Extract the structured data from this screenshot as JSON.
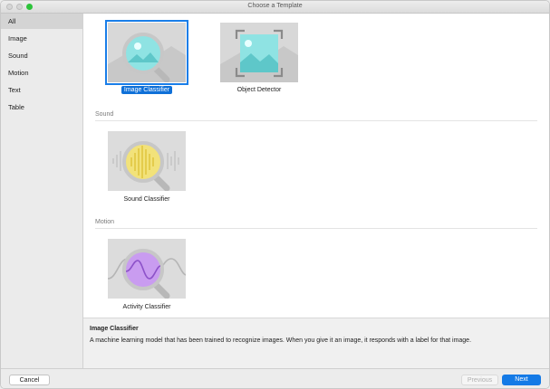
{
  "window": {
    "title": "Choose a Template"
  },
  "sidebar": {
    "items": [
      {
        "label": "All"
      },
      {
        "label": "Image"
      },
      {
        "label": "Sound"
      },
      {
        "label": "Motion"
      },
      {
        "label": "Text"
      },
      {
        "label": "Table"
      }
    ],
    "selected": "All"
  },
  "sections": {
    "image": {
      "header": "",
      "templates": [
        {
          "label": "Image Classifier",
          "selected": true,
          "icon": "image-classifier-icon"
        },
        {
          "label": "Object Detector",
          "selected": false,
          "icon": "object-detector-icon"
        }
      ]
    },
    "sound": {
      "header": "Sound",
      "templates": [
        {
          "label": "Sound Classifier",
          "selected": false,
          "icon": "sound-classifier-icon"
        }
      ]
    },
    "motion": {
      "header": "Motion",
      "templates": [
        {
          "label": "Activity Classifier",
          "selected": false,
          "icon": "activity-classifier-icon"
        }
      ]
    }
  },
  "description": {
    "title": "Image Classifier",
    "text": "A machine learning model that has been trained to recognize images. When you give it an image, it responds with a label for that image."
  },
  "footer": {
    "cancel_label": "Cancel",
    "previous_label": "Previous",
    "next_label": "Next"
  },
  "colors": {
    "accent": "#147ae6",
    "image_teal": "#8fe3e3",
    "sound_yellow": "#f2e27a",
    "motion_purple": "#c99cf0"
  }
}
